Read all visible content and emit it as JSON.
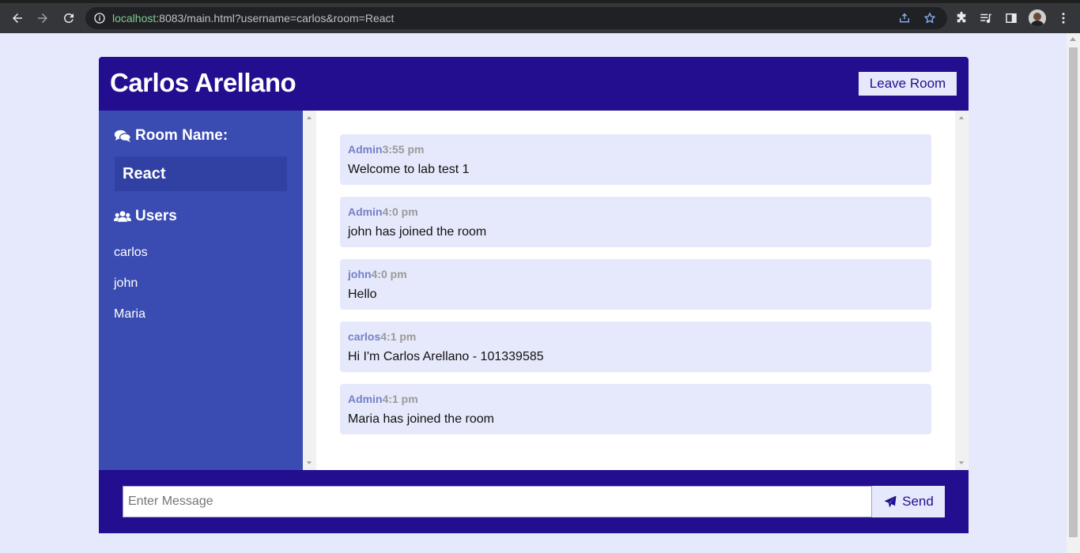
{
  "browser": {
    "url_host": "localhost",
    "url_rest": ":8083/main.html?username=carlos&room=React",
    "nav_icons": [
      "back-icon",
      "forward-icon",
      "reload-icon"
    ],
    "omnibox_icons": [
      "info-icon",
      "share-icon",
      "bookmark-star-icon"
    ],
    "toolbar_icons": [
      "extensions-icon",
      "media-queue-icon",
      "side-panel-icon",
      "profile-avatar",
      "menu-icon"
    ]
  },
  "app": {
    "title": "Carlos Arellano",
    "leave_label": "Leave Room",
    "colors": {
      "header": "#230e8f",
      "sidebar": "#3a4bb1",
      "bubble": "#e6e9fb",
      "username": "#7481c9"
    }
  },
  "sidebar": {
    "room_heading": "Room Name:",
    "room_name": "React",
    "users_heading": "Users",
    "users": [
      "carlos",
      "john",
      "Maria"
    ]
  },
  "messages": [
    {
      "user": "Admin",
      "time": "3:55 pm",
      "text": "Welcome to lab test 1"
    },
    {
      "user": "Admin",
      "time": "4:0 pm",
      "text": "john has joined the room"
    },
    {
      "user": "john",
      "time": "4:0 pm",
      "text": "Hello"
    },
    {
      "user": "carlos",
      "time": "4:1 pm",
      "text": "Hi I'm Carlos Arellano - 101339585"
    },
    {
      "user": "Admin",
      "time": "4:1 pm",
      "text": "Maria has joined the room"
    }
  ],
  "composer": {
    "placeholder": "Enter Message",
    "value": "",
    "send_label": "Send"
  }
}
